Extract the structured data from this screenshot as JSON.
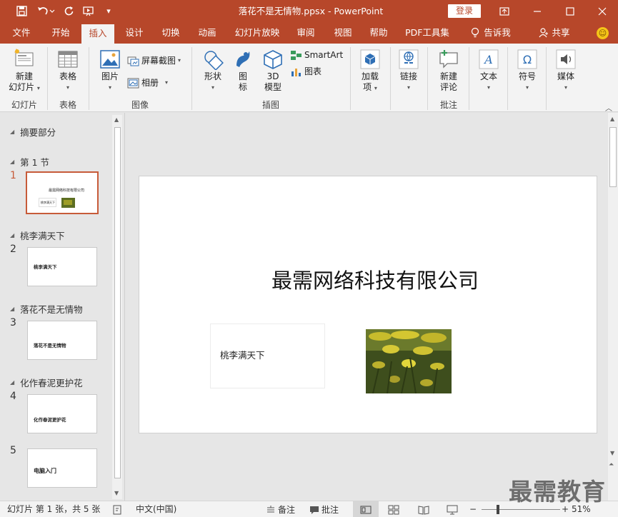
{
  "window": {
    "title": "落花不是无情物.ppsx  -  PowerPoint",
    "login_label": "登录"
  },
  "tabs": [
    {
      "label": "文件"
    },
    {
      "label": "开始"
    },
    {
      "label": "插入"
    },
    {
      "label": "设计"
    },
    {
      "label": "切换"
    },
    {
      "label": "动画"
    },
    {
      "label": "幻灯片放映"
    },
    {
      "label": "审阅"
    },
    {
      "label": "视图"
    },
    {
      "label": "帮助"
    },
    {
      "label": "PDF工具集"
    },
    {
      "label": "告诉我"
    },
    {
      "label": "共享"
    }
  ],
  "ribbon": {
    "new_slide": "新建",
    "new_slide_2": "幻灯片",
    "group_slides": "幻灯片",
    "table": "表格",
    "group_table": "表格",
    "picture": "图片",
    "screenshot": "屏幕截图",
    "album": "相册",
    "group_images": "图像",
    "shapes": "形状",
    "icons": "图",
    "icons_2": "标",
    "model_3d": "3D",
    "model_3d_2": "模型",
    "smartart": "SmartArt",
    "chart": "图表",
    "group_illustrations": "插图",
    "addins": "加载",
    "addins_2": "项",
    "links": "链接",
    "new_comment": "新建",
    "new_comment_2": "评论",
    "group_comments": "批注",
    "text": "文本",
    "symbols": "符号",
    "media": "媒体"
  },
  "sections": [
    {
      "name": "摘要部分"
    },
    {
      "name": "第 1 节"
    },
    {
      "name": "桃李满天下"
    },
    {
      "name": "落花不是无情物"
    },
    {
      "name": "化作春泥更护花"
    }
  ],
  "slides": [
    {
      "number": "1",
      "thumb_text": "最需网络科技有限公司",
      "thumb_box": "桃李满天下"
    },
    {
      "number": "2",
      "thumb_text": "桃李满天下"
    },
    {
      "number": "3",
      "thumb_text": "落花不是无情物"
    },
    {
      "number": "4",
      "thumb_text": "化作春泥更护花"
    },
    {
      "number": "5",
      "thumb_text": "电脑入门"
    }
  ],
  "current_slide": {
    "title": "最需网络科技有限公司",
    "textbox": "桃李满天下"
  },
  "status": {
    "slide_info": "幻灯片 第 1 张，共 5 张",
    "language": "中文(中国)",
    "notes": "备注",
    "comments": "批注",
    "zoom": "51%"
  },
  "watermark": "最需教育",
  "colors": {
    "accent": "#b7472a",
    "selected_thumb": "#c75b39"
  }
}
